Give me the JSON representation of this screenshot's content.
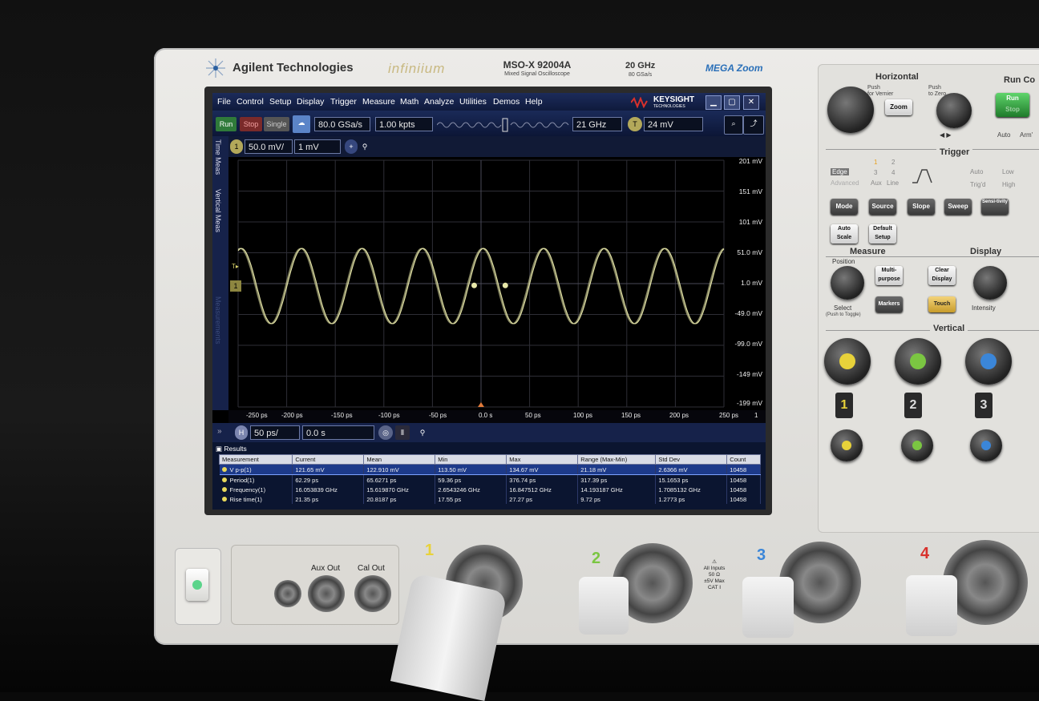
{
  "instrument": {
    "brand": "Agilent Technologies",
    "series": "infiniium",
    "model": "MSO-X 92004A",
    "model_sub": "Mixed Signal Oscilloscope",
    "bandwidth": "20 GHz",
    "sample_rate_spec": "80 GSa/s",
    "megazoom": "MEGA Zoom"
  },
  "menubar": {
    "items": [
      "File",
      "Control",
      "Setup",
      "Display",
      "Trigger",
      "Measure",
      "Math",
      "Analyze",
      "Utilities",
      "Demos",
      "Help"
    ],
    "logo": "KEYSIGHT",
    "logo_sub": "TECHNOLOGIES"
  },
  "toolbar": {
    "run": "Run",
    "stop": "Stop",
    "single": "Single",
    "sample_rate": "80.0 GSa/s",
    "memory_depth": "1.00 kpts",
    "bandwidth": "21 GHz",
    "trigger_level": "24 mV",
    "trigger_icon": "T"
  },
  "channel_bar": {
    "channel": "1",
    "scale": "50.0 mV/",
    "offset": "1 mV"
  },
  "side_tabs": [
    "Time Meas",
    "Vertical Meas",
    "Measurements"
  ],
  "y_axis_labels": [
    "201 mV",
    "151 mV",
    "101 mV",
    "51.0 mV",
    "1.0 mV",
    "-49.0 mV",
    "-99.0 mV",
    "-149 mV",
    "-199 mV"
  ],
  "x_axis_labels": [
    "-250 ps",
    "-200 ps",
    "-150 ps",
    "-100 ps",
    "-50 ps",
    "0.0 s",
    "50 ps",
    "100 ps",
    "150 ps",
    "200 ps",
    "250 ps"
  ],
  "x_axis_page": "1",
  "horizontal_bar": {
    "icon": "H",
    "time_scale": "50 ps/",
    "position": "0.0 s"
  },
  "results": {
    "tab": "Results",
    "columns": [
      "Measurement",
      "Current",
      "Mean",
      "Min",
      "Max",
      "Range (Max-Min)",
      "Std Dev",
      "Count"
    ],
    "rows": [
      [
        "V p-p(1)",
        "121.65 mV",
        "122.910 mV",
        "113.50 mV",
        "134.67 mV",
        "21.18 mV",
        "2.6366 mV",
        "10458"
      ],
      [
        "Period(1)",
        "62.29 ps",
        "65.6271 ps",
        "59.36 ps",
        "376.74 ps",
        "317.39 ps",
        "15.1653 ps",
        "10458"
      ],
      [
        "Frequency(1)",
        "16.053839 GHz",
        "15.619870 GHz",
        "2.6543246 GHz",
        "16.847512 GHz",
        "14.193187 GHz",
        "1.7085132 GHz",
        "10458"
      ],
      [
        "Rise time(1)",
        "21.35 ps",
        "20.8187 ps",
        "17.55 ps",
        "27.27 ps",
        "9.72 ps",
        "1.2773 ps",
        "10458"
      ]
    ]
  },
  "waveform": {
    "type": "line",
    "title": "",
    "series": [
      {
        "name": "",
        "color": "#e6e6a8"
      }
    ],
    "xlim_ps": [
      -250,
      250
    ],
    "ylim_mV": [
      -199,
      201
    ],
    "amplitude_mV": 61,
    "offset_mV": -3,
    "period_ps": 62.29
  },
  "panel": {
    "horizontal": "Horizontal",
    "run_control": "Run Co",
    "push_vernier": "Push",
    "for_vernier": "for Vernier",
    "push_zero": "Push",
    "to_zero": "to Zero",
    "zoom": "Zoom",
    "run_btn": "Run",
    "stop_btn": "Stop",
    "auto": "Auto",
    "arm": "Arm'",
    "trigger": "Trigger",
    "edge": "Edge",
    "advanced": "Advanced",
    "src1": "1",
    "src2": "2",
    "src3": "3",
    "src4": "4",
    "aux": "Aux",
    "line": "Line",
    "trig_d": "Trig'd",
    "auto2": "Auto",
    "low": "Low",
    "high": "High",
    "mode": "Mode",
    "source": "Source",
    "slope": "Slope",
    "sweep": "Sweep",
    "sensitivity": "Sensi-tivity",
    "auto_scale": "Auto Scale",
    "default_setup": "Default Setup",
    "measure": "Measure",
    "display": "Display",
    "position": "Position",
    "multi_purpose": "Multi-purpose",
    "clear_display": "Clear Display",
    "select": "Select",
    "push_toggle": "(Push to Toggle)",
    "markers": "Markers",
    "touch": "Touch",
    "intensity": "Intensity",
    "vertical": "Vertical",
    "ch1": "1",
    "ch2": "2",
    "ch3": "3"
  },
  "front": {
    "aux_out": "Aux Out",
    "cal_out": "Cal Out",
    "ch1": "1",
    "ch2": "2",
    "ch3": "3",
    "ch4": "4",
    "all_inputs": "All Inputs",
    "ohms": "50 Ω",
    "max_v": "±5V Max",
    "cat": "CAT I"
  },
  "colors": {
    "ch1": "#e8d23a",
    "ch2": "#7bc642",
    "ch3": "#3b86d8",
    "ch4": "#d8312c",
    "run_green": "#3fb64a",
    "stop_red": "#c9332c",
    "screen_menu": "#1c2b5a"
  }
}
